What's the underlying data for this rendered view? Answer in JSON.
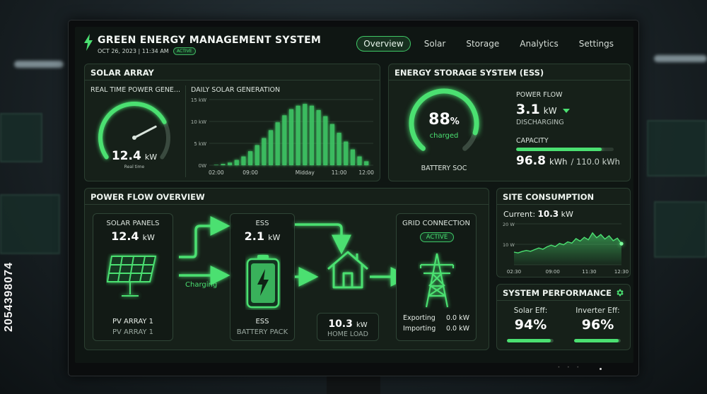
{
  "app": {
    "title": "GREEN ENERGY MANAGEMENT SYSTEM",
    "datetime": "OCT 26, 2023 | 11:34 AM",
    "status": "ACTIVE"
  },
  "nav": {
    "items": [
      "Overview",
      "Solar",
      "Storage",
      "Analytics",
      "Settings"
    ],
    "active": "Overview"
  },
  "solar": {
    "title": "SOLAR ARRAY",
    "realtime_label": "REAL TIME POWER GENE...",
    "power_value": "12.4",
    "power_unit": "kW",
    "gauge_caption": "Real time",
    "gauge_fraction": 0.75,
    "daily_label": "DAILY SOLAR GENERATION"
  },
  "chart_data": {
    "type": "bar",
    "title": "DAILY SOLAR GENERATION",
    "categories": [
      "02:00",
      "",
      "",
      "",
      "",
      "09:00",
      "",
      "",
      "",
      "",
      "",
      "",
      "",
      "Midday",
      "",
      "",
      "",
      "",
      "11:00",
      "",
      "",
      "",
      "12:00"
    ],
    "x_ticks": [
      "02:00",
      "09:00",
      "Midday",
      "11:00",
      "12:00"
    ],
    "y_ticks": [
      "15 kW",
      "10 kW",
      "5 kW",
      "0W"
    ],
    "ylim": [
      0,
      15
    ],
    "values": [
      0.1,
      0.3,
      0.6,
      1.2,
      2.0,
      3.2,
      4.6,
      6.2,
      8.0,
      9.8,
      11.4,
      12.8,
      13.6,
      14.0,
      13.6,
      12.6,
      11.2,
      9.4,
      7.4,
      5.4,
      3.6,
      2.0,
      0.9
    ],
    "grid": true
  },
  "ess": {
    "title": "ENERGY STORAGE SYSTEM (ESS)",
    "soc_value": "88",
    "soc_unit": "%",
    "soc_caption": "charged",
    "soc_label": "BATTERY SOC",
    "soc_fraction": 0.88,
    "flow_label": "POWER FLOW",
    "flow_value": "3.1",
    "flow_unit": "kW",
    "flow_state": "DISCHARGING",
    "capacity_label": "CAPACITY",
    "capacity_value": "96.8",
    "capacity_unit": "kWh",
    "capacity_total": "/ 110.0 kWh",
    "capacity_fraction": 0.88
  },
  "power_flow": {
    "title": "POWER FLOW OVERVIEW",
    "solar_label": "SOLAR PANELS",
    "solar_value": "12.4",
    "solar_unit": "kW",
    "solar_name": "PV ARRAY 1",
    "solar_sub": "PV ARRAY 1",
    "charging_label": "Charging",
    "ess_label": "ESS",
    "ess_value": "2.1",
    "ess_unit": "kW",
    "ess_name": "ESS",
    "ess_sub": "BATTERY PACK",
    "home_value": "10.3",
    "home_unit": "kW",
    "home_label": "HOME LOAD",
    "grid_label": "GRID CONNECTION",
    "grid_status": "ACTIVE",
    "exporting_label": "Exporting",
    "exporting_value": "0.0 kW",
    "importing_label": "Importing",
    "importing_value": "0.0 kW"
  },
  "consumption": {
    "title": "SITE CONSUMPTION",
    "current_label": "Current:",
    "current_value": "10.3",
    "current_unit": "kW",
    "y_ticks": [
      "20 W",
      "10 W"
    ],
    "x_ticks": [
      "02:30",
      "09:00",
      "11:30",
      "12:30"
    ],
    "series": [
      6.2,
      5.8,
      6.5,
      7.0,
      6.6,
      7.4,
      8.2,
      7.6,
      8.8,
      9.6,
      8.9,
      10.4,
      9.8,
      11.2,
      10.6,
      12.8,
      11.6,
      13.4,
      12.2,
      15.6,
      13.2,
      14.8,
      12.6,
      14.2,
      11.8,
      13.0,
      10.3
    ],
    "ylim": [
      0,
      20
    ]
  },
  "performance": {
    "title": "SYSTEM PERFORMANCE",
    "solar_label": "Solar Eff:",
    "solar_value": "94%",
    "solar_fraction": 0.94,
    "inverter_label": "Inverter Eff:",
    "inverter_value": "96%",
    "inverter_fraction": 0.96
  },
  "colors": {
    "accent": "#4be071",
    "panel": "#162019",
    "border": "#2b3f31"
  },
  "icons": [
    "bolt-icon",
    "sun-panel-icon",
    "battery-icon",
    "house-icon",
    "pylon-icon",
    "gear-icon",
    "chevron-down-icon"
  ]
}
